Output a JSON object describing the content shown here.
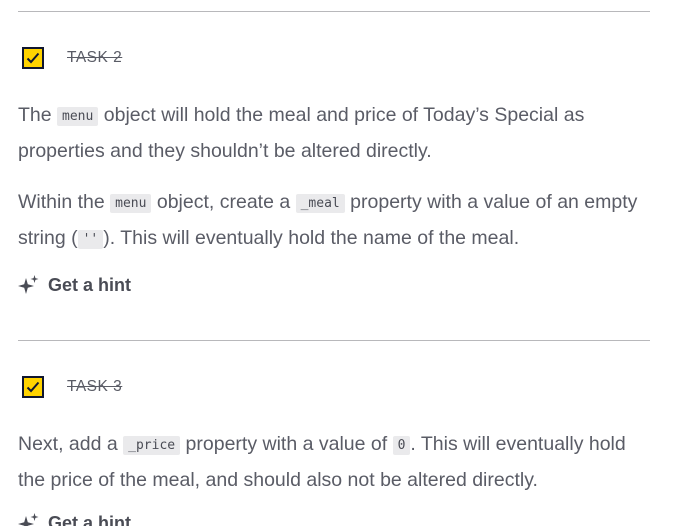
{
  "task2": {
    "label": "TASK 2",
    "checked": true,
    "para1": {
      "t1": "The ",
      "code1": "menu",
      "t2": " object will hold the meal and price of Today’s Special as properties and they shouldn’t be altered directly."
    },
    "para2": {
      "t1": "Within the ",
      "code1": "menu",
      "t2": " object, create a ",
      "code2": "_meal",
      "t3": " property with a value of an empty string (",
      "code3": "''",
      "t4": "). This will eventually hold the name of the meal."
    },
    "hint_label": "Get a hint"
  },
  "task3": {
    "label": "TASK 3",
    "checked": true,
    "para1": {
      "t1": "Next, add a ",
      "code1": "_price",
      "t2": " property with a value of ",
      "code2": "0",
      "t3": ". This will eventually hold the price of the meal, and should also not be altered directly."
    },
    "hint_label": "Get a hint"
  },
  "icons": {
    "check": "checkmark-icon",
    "hint": "sparkle-icon"
  },
  "colors": {
    "checkbox_fill": "#ffd300",
    "checkbox_border": "#10162f",
    "text": "#5a5c66",
    "code_bg": "#eaeaec"
  }
}
